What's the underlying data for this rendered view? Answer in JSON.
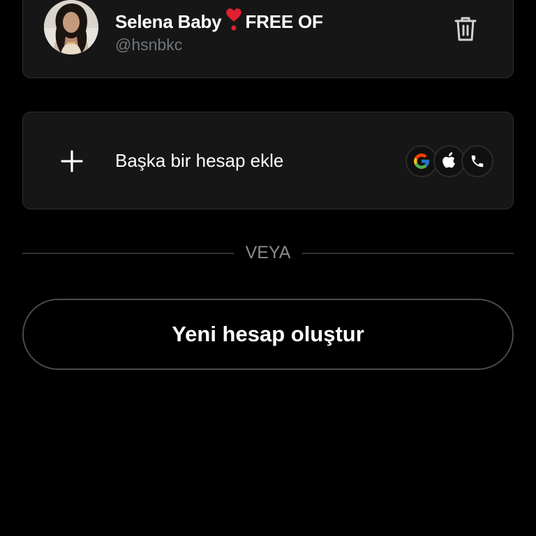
{
  "account": {
    "display_name": "Selena Baby",
    "name_suffix": "FREE OF",
    "username": "@hsnbkc",
    "heart_emoji": "heart-exclamation-icon"
  },
  "add_account": {
    "label": "Başka bir hesap ekle",
    "providers": [
      "google-icon",
      "apple-icon",
      "phone-icon"
    ]
  },
  "separator": {
    "text": "VEYA"
  },
  "create_account": {
    "label": "Yeni hesap oluştur"
  },
  "colors": {
    "background": "#000000",
    "card": "#161616",
    "card_border": "#2f2f2f",
    "muted_text": "#71767b",
    "heart": "#e0202f"
  }
}
